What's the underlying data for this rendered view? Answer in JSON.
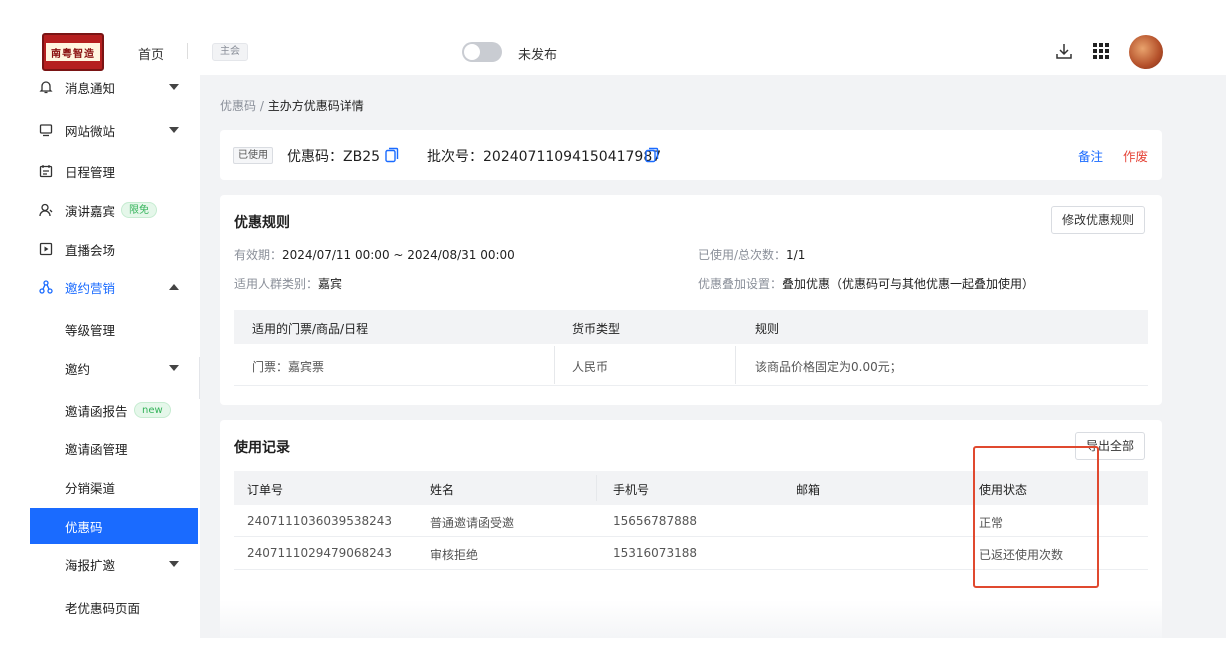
{
  "topbar": {
    "logo_text": "南粤智造",
    "home": "首页",
    "main_tag": "主会",
    "publish_status": "未发布",
    "icons": [
      "download-icon",
      "apps-grid-icon"
    ]
  },
  "sidebar": {
    "items": [
      {
        "label": "消息通知",
        "icon": "bell-icon"
      },
      {
        "label": "网站微站",
        "icon": "monitor-icon"
      },
      {
        "label": "日程管理",
        "icon": "calendar-icon"
      },
      {
        "label": "演讲嘉宾",
        "icon": "user-icon",
        "badge": "限免"
      },
      {
        "label": "直播会场",
        "icon": "live-icon"
      },
      {
        "label": "邀约营销",
        "icon": "share-icon"
      },
      {
        "label": "等级管理"
      },
      {
        "label": "邀约"
      },
      {
        "label": "邀请函报告",
        "badge": "new"
      },
      {
        "label": "邀请函管理"
      },
      {
        "label": "分销渠道"
      },
      {
        "label": "优惠码"
      },
      {
        "label": "海报扩邀"
      },
      {
        "label": "老优惠码页面"
      }
    ]
  },
  "breadcrumb": {
    "parent": "优惠码",
    "separator": " / ",
    "current": "主办方优惠码详情"
  },
  "code_card": {
    "status": "已使用",
    "code_label": "优惠码：",
    "code": "ZB25",
    "batch_label": "批次号：",
    "batch": "20240711094150417987",
    "note_link": "备注",
    "void_link": "作废"
  },
  "rules_card": {
    "title": "优惠规则",
    "edit_button": "修改优惠规则",
    "validity_label": "有效期：",
    "validity": "2024/07/11 00:00 ~ 2024/08/31 00:00",
    "audience_label": "适用人群类别：",
    "audience": "嘉宾",
    "usage_label": "已使用/总次数：",
    "usage": "1/1",
    "stacking_label": "优惠叠加设置：",
    "stacking": "叠加优惠（优惠码可与其他优惠一起叠加使用）",
    "table": {
      "headers": [
        "适用的门票/商品/日程",
        "货币类型",
        "规则"
      ],
      "rows": [
        [
          "门票：嘉宾票",
          "人民币",
          "该商品价格固定为0.00元；"
        ]
      ]
    }
  },
  "records_card": {
    "title": "使用记录",
    "export_button": "导出全部",
    "table": {
      "headers": [
        "订单号",
        "姓名",
        "手机号",
        "邮箱",
        "使用状态"
      ],
      "rows": [
        [
          "2407111036039538243",
          "普通邀请函受邀",
          "15656787888",
          "",
          "正常"
        ],
        [
          "2407111029479068243",
          "审核拒绝",
          "15316073188",
          "",
          "已返还使用次数"
        ]
      ]
    }
  },
  "colors": {
    "accent": "#1a6bff",
    "danger": "#e5463a",
    "highlight": "#e0492f"
  }
}
